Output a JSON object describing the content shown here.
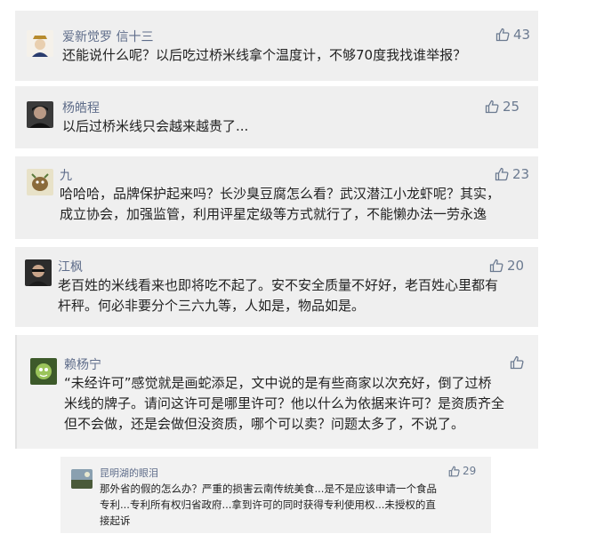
{
  "comments": [
    {
      "username": "爱新觉罗 信十三",
      "likes": "43",
      "lines": [
        "还能说什么呢？以后吃过桥米线拿个温度计，不够70度我找谁举报？"
      ],
      "icon": "thumbs-up-icon"
    },
    {
      "username": "杨皓程",
      "likes": "25",
      "lines": [
        "以后过桥米线只会越来越贵了..."
      ],
      "icon": "thumbs-up-icon"
    },
    {
      "username": "九",
      "likes": "23",
      "lines": [
        "哈哈哈，品牌保护起来吗？长沙臭豆腐怎么看？武汉潜江小龙虾呢？其实，",
        "成立协会，加强监管，利用评星定级等方式就行了，不能懒办法一劳永逸"
      ],
      "icon": "thumbs-up-icon"
    },
    {
      "username": "江枫",
      "likes": "20",
      "lines": [
        "老百姓的米线看来也即将吃不起了。安不安全质量不好好，老百姓心里都有",
        "杆秤。何必非要分个三六九等，人如是，物品如是。"
      ],
      "icon": "thumbs-up-icon"
    },
    {
      "username": "赖杨宁",
      "likes": "",
      "lines": [
        "“未经许可”感觉就是画蛇添足，文中说的是有些商家以次充好，倒了过桥",
        "米线的牌子。请问这许可是哪里许可？他以什么为依据来许可？是资质齐全",
        "但不会做，还是会做但没资质，哪个可以卖？问题太多了，不说了。"
      ],
      "icon": "thumbs-up-icon"
    },
    {
      "username": "昆明湖的眼泪",
      "likes": "29",
      "lines": [
        "那外省的假的怎么办？严重的损害云南传统美食...是不是应该申请一个食品",
        "专利...专利所有权归省政府...拿到许可的同时获得专利使用权...未授权的直",
        "接起诉"
      ],
      "icon": "thumbs-up-icon"
    }
  ]
}
